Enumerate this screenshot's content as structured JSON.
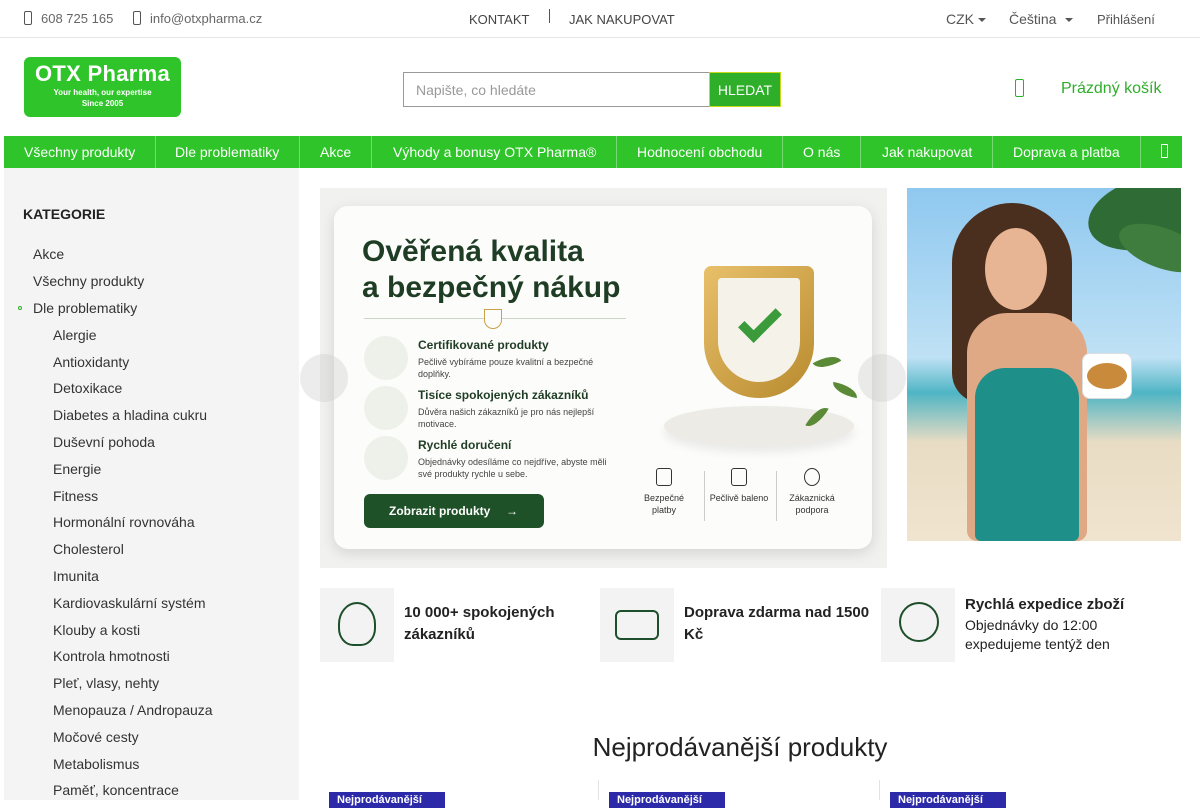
{
  "topbar": {
    "phone": "608 725 165",
    "email": "info@otxpharma.cz",
    "links": [
      "KONTAKT",
      "JAK NAKUPOVAT"
    ],
    "currency": "CZK",
    "language": "Čeština",
    "login": "Přihlášení"
  },
  "logo": {
    "name": "OTX Pharma",
    "tagline": "Your health, our expertise",
    "since": "Since 2005"
  },
  "search": {
    "placeholder": "Napište, co hledáte",
    "button": "HLEDAT"
  },
  "cart": {
    "label": "Prázdný košík"
  },
  "nav": [
    "Všechny produkty",
    "Dle problematiky",
    "Akce",
    "Výhody a bonusy OTX Pharma®",
    "Hodnocení obchodu",
    "O nás",
    "Jak nakupovat",
    "Doprava a platba"
  ],
  "sidebar": {
    "heading": "KATEGORIE",
    "top": [
      "Akce",
      "Všechny produkty",
      "Dle problematiky"
    ],
    "sub": [
      "Alergie",
      "Antioxidanty",
      "Detoxikace",
      "Diabetes a hladina cukru",
      "Duševní pohoda",
      "Energie",
      "Fitness",
      "Hormonální rovnováha",
      "Cholesterol",
      "Imunita",
      "Kardiovaskulární systém",
      "Klouby a kosti",
      "Kontrola hmotnosti",
      "Pleť, vlasy, nehty",
      "Menopauza / Andropauza",
      "Močové cesty",
      "Metabolismus",
      "Paměť, koncentrace"
    ]
  },
  "banner": {
    "headline1": "Ověřená kvalita",
    "headline2": "a bezpečný nákup",
    "features": [
      {
        "title": "Certifikované produkty",
        "desc": "Pečlivě vybíráme pouze kvalitní a bezpečné doplňky.",
        "icon": "certificate-icon"
      },
      {
        "title": "Tisíce spokojených zákazníků",
        "desc": "Důvěra našich zákazníků je pro nás nejlepší motivace.",
        "icon": "people-icon"
      },
      {
        "title": "Rychlé doručení",
        "desc": "Objednávky odesíláme co nejdříve, abyste měli své produkty rychle u sebe.",
        "icon": "truck-icon"
      }
    ],
    "cta": "Zobrazit produkty",
    "footer_items": [
      "Bezpečné platby",
      "Pečlivě baleno",
      "Zákaznická podpora"
    ]
  },
  "usps": [
    {
      "title": "10 000+ spokojených zákazníků",
      "desc": ""
    },
    {
      "title": "Doprava zdarma nad 1500 Kč",
      "desc": ""
    },
    {
      "title": "Rychlá expedice zboží",
      "desc": "Objednávky do 12:00 expedujeme tentýž den"
    }
  ],
  "bestsellers": {
    "title": "Nejprodávanější produkty",
    "badge": "Nejprodávanější"
  }
}
